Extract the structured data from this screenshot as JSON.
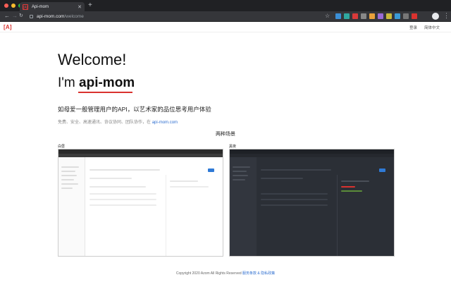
{
  "browser": {
    "tab_title": "Api-mom",
    "tab_favicon": "[A]",
    "url_host": "api-mom.com",
    "url_path": "/welcome",
    "extension_colors": [
      "#3b8fd6",
      "#2fa8a0",
      "#d93a3a",
      "#888888",
      "#e8a03a",
      "#9a6ad6",
      "#c9b93a",
      "#3a9ad6",
      "#777777",
      "#d9322f"
    ]
  },
  "site": {
    "logo": "[A]",
    "nav": {
      "login": "登录",
      "language": "简体中文"
    },
    "accent_color": "#d9322f"
  },
  "hero": {
    "welcome": "Welcome!",
    "im_prefix": "I'm ",
    "brand": "api-mom",
    "tagline": "如母爱一般管理用户的API，以艺术家的品位思考用户体验",
    "features": "免费、安全、高速通讯、协议协同、团队协作，在",
    "features_link": "api-mom.com"
  },
  "scenes": {
    "title": "两种场景",
    "left_label": "白昼",
    "right_label": "黑夜"
  },
  "footer": {
    "copyright": "Copyright 2020 Azom All Rights Reserved",
    "links": "服务条款 & 隐私政策"
  }
}
